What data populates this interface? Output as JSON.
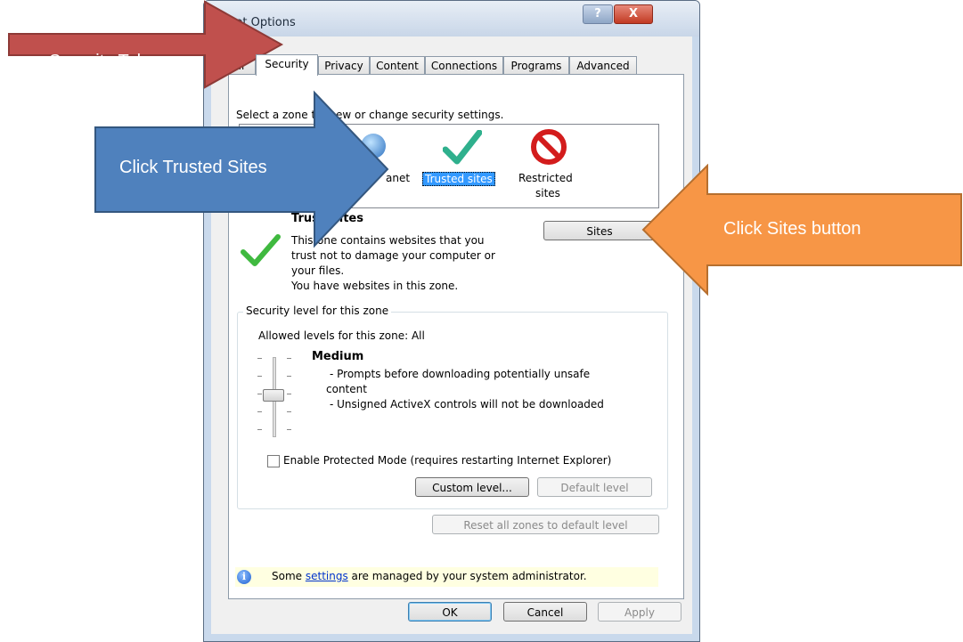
{
  "window": {
    "title": "ernet Options",
    "help_btn": "?",
    "close_btn": "X"
  },
  "tabs": [
    {
      "label": "al"
    },
    {
      "label": "Security"
    },
    {
      "label": "Privacy"
    },
    {
      "label": "Content"
    },
    {
      "label": "Connections"
    },
    {
      "label": "Programs"
    },
    {
      "label": "Advanced"
    }
  ],
  "zones": {
    "prompt": "Select a zone t",
    "prompt_tail": "ew or change security settings.",
    "items": [
      {
        "label": "anet",
        "icon": "local-intranet-icon"
      },
      {
        "label": "Trusted sites",
        "icon": "checkmark-icon"
      },
      {
        "label_line1": "Restricted",
        "label_line2": "sites",
        "icon": "restricted-icon"
      }
    ]
  },
  "zone_info": {
    "title_part1": "Trus",
    "title_part2": "sites",
    "desc_line1": "This",
    "desc_line1_tail": "one contains websites that you",
    "desc_line2": "trust not to damage your computer or",
    "desc_line3": "your files.",
    "desc_line4": "You have websites in this zone.",
    "sites_button": "Sites"
  },
  "security_level": {
    "legend": "Security level for this zone",
    "allowed": "Allowed levels for this zone: All",
    "level_name": "Medium",
    "bullet1_line1": "- Prompts before downloading potentially unsafe",
    "bullet1_line2": "content",
    "bullet2": "- Unsigned ActiveX controls will not be downloaded",
    "protected_mode": "Enable Protected Mode (requires restarting Internet Explorer)",
    "protected_mode_checked": false,
    "custom_level": "Custom level...",
    "default_level": "Default level"
  },
  "reset_button": "Reset all zones to default level",
  "info": {
    "before": "Some ",
    "link": "settings",
    "after": " are managed by your system administrator."
  },
  "footer": {
    "ok": "OK",
    "cancel": "Cancel",
    "apply": "Apply"
  },
  "annotations": {
    "security_tab": {
      "text": "Security Tab",
      "color": "#c0504d"
    },
    "trusted_sites": {
      "text": "Click Trusted Sites",
      "color": "#4f81bd"
    },
    "sites_button": {
      "text": "Click Sites button",
      "color": "#f79646"
    }
  }
}
